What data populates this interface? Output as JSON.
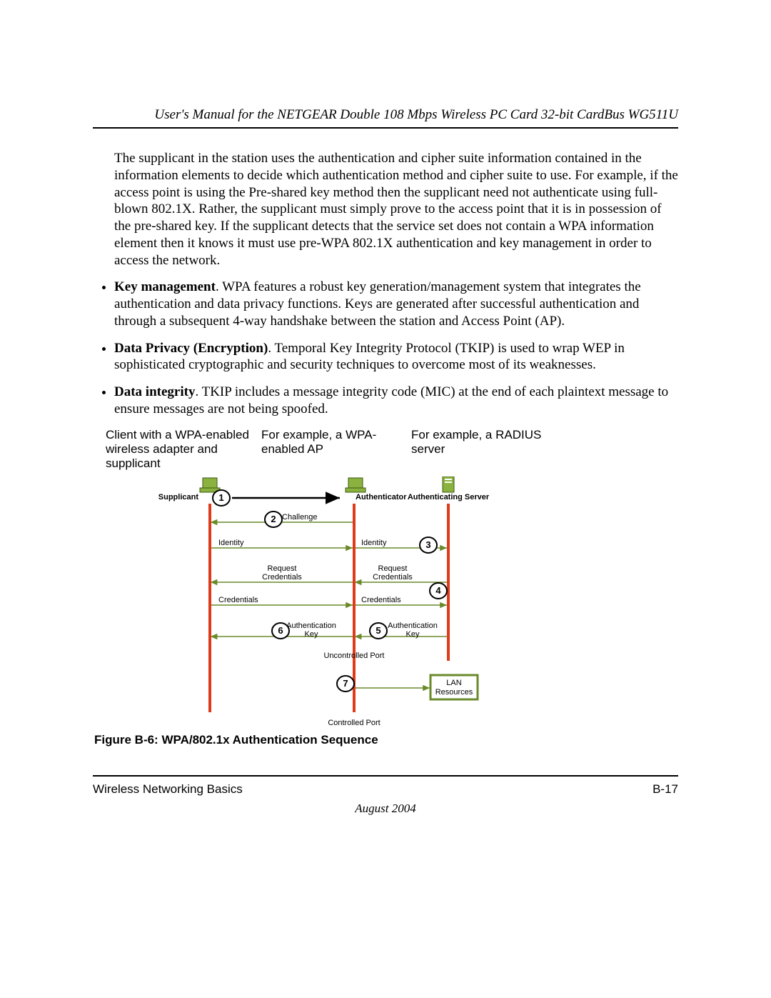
{
  "header": {
    "title": "User's Manual for the NETGEAR Double 108 Mbps Wireless PC Card 32-bit CardBus WG511U"
  },
  "paragraphs": {
    "intro": "The supplicant in the station uses the authentication and cipher suite information contained in the information elements to decide which authentication method and cipher suite to use. For example, if the access point is using the Pre-shared key method then the supplicant need not authenticate using full-blown 802.1X. Rather, the supplicant must simply prove to the access point that it is in possession of the pre-shared key. If the supplicant detects that the service set does not contain a WPA information element then it knows it must use pre-WPA 802.1X authentication and key management in order to access the network."
  },
  "bullets": [
    {
      "title": "Key management",
      "text": ". WPA features a robust key generation/management system that integrates the authentication and data privacy functions. Keys are generated after successful authentication and through a subsequent 4-way handshake between the station and Access Point (AP)."
    },
    {
      "title": "Data Privacy (Encryption)",
      "text": ". Temporal Key Integrity Protocol (TKIP) is used to wrap WEP in sophisticated cryptographic and security techniques to overcome most of its weaknesses."
    },
    {
      "title": "Data integrity",
      "text": ". TKIP includes a message integrity code (MIC) at the end of each plaintext message to ensure messages are not being spoofed."
    }
  ],
  "figure_top_labels": {
    "col1": "Client with a WPA-enabled wireless adapter and supplicant",
    "col2": "For example, a WPA-enabled AP",
    "col3": "For example, a RADIUS server"
  },
  "diagram": {
    "actors": {
      "supplicant": "Supplicant",
      "authenticator": "Authenticator",
      "authserver": "Authenticating Server"
    },
    "steps": {
      "s1": "1",
      "s2": "2",
      "s3": "3",
      "s4": "4",
      "s5": "5",
      "s6": "6",
      "s7": "7"
    },
    "labels": {
      "challenge": "Challenge",
      "identity_l": "Identity",
      "identity_r": "Identity",
      "reqcred_l_line1": "Request",
      "reqcred_l_line2": "Credentials",
      "reqcred_r_line1": "Request",
      "reqcred_r_line2": "Credentials",
      "cred_l": "Credentials",
      "cred_r": "Credentials",
      "authkey_l_line1": "Authentication",
      "authkey_l_line2": "Key",
      "authkey_r_line1": "Authentication",
      "authkey_r_line2": "Key",
      "uncontrolled": "Uncontrolled Port",
      "controlled": "Controlled Port",
      "lan_line1": "LAN",
      "lan_line2": "Resources"
    }
  },
  "figure_caption": "Figure B-6:  WPA/802.1x Authentication Sequence",
  "footer": {
    "left": "Wireless Networking Basics",
    "right": "B-17",
    "date": "August 2004"
  }
}
